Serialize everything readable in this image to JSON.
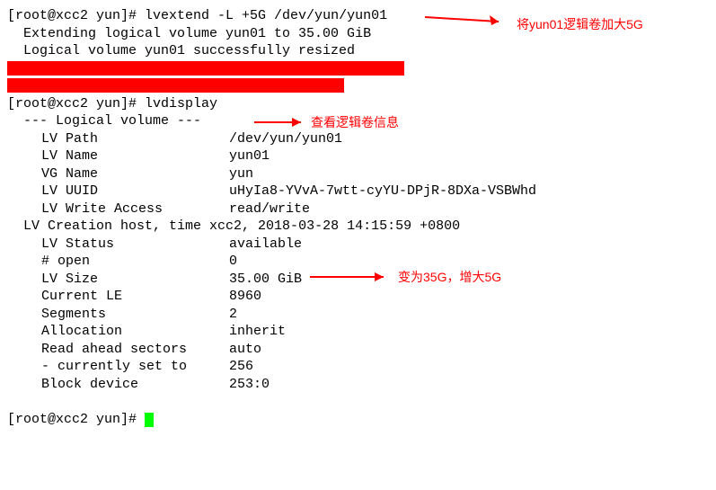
{
  "prompt1": "[root@xcc2 yun]# ",
  "cmd1": "lvextend -L +5G /dev/yun/yun01",
  "output1": "  Extending logical volume yun01 to 35.00 GiB",
  "output2": "  Logical volume yun01 successfully resized",
  "prompt2": "[root@xcc2 yun]# ",
  "cmd2": "lvdisplay",
  "lv_header": "  --- Logical volume ---",
  "fields": {
    "path_label": "  LV Path",
    "path_value": "/dev/yun/yun01",
    "name_label": "  LV Name",
    "name_value": "yun01",
    "vg_label": "  VG Name",
    "vg_value": "yun",
    "uuid_label": "  LV UUID",
    "uuid_value": "uHyIa8-YVvA-7wtt-cyYU-DPjR-8DXa-VSBWhd",
    "access_label": "  LV Write Access",
    "access_value": "read/write",
    "creation_label": "  LV Creation host, time ",
    "creation_value": "xcc2, 2018-03-28 14:15:59 +0800",
    "status_label": "  LV Status",
    "status_value": "available",
    "open_label": "  # open",
    "open_value": "0",
    "size_label": "  LV Size",
    "size_value": "35.00 GiB",
    "le_label": "  Current LE",
    "le_value": "8960",
    "segments_label": "  Segments",
    "segments_value": "2",
    "alloc_label": "  Allocation",
    "alloc_value": "inherit",
    "readahead_label": "  Read ahead sectors",
    "readahead_value": "auto",
    "currently_label": "  - currently set to",
    "currently_value": "256",
    "block_label": "  Block device",
    "block_value": "253:0"
  },
  "prompt3": "[root@xcc2 yun]# ",
  "annotations": {
    "a1": "将yun01逻辑卷加大5G",
    "a2": "查看逻辑卷信息",
    "a3": "变为35G，增大5G"
  }
}
